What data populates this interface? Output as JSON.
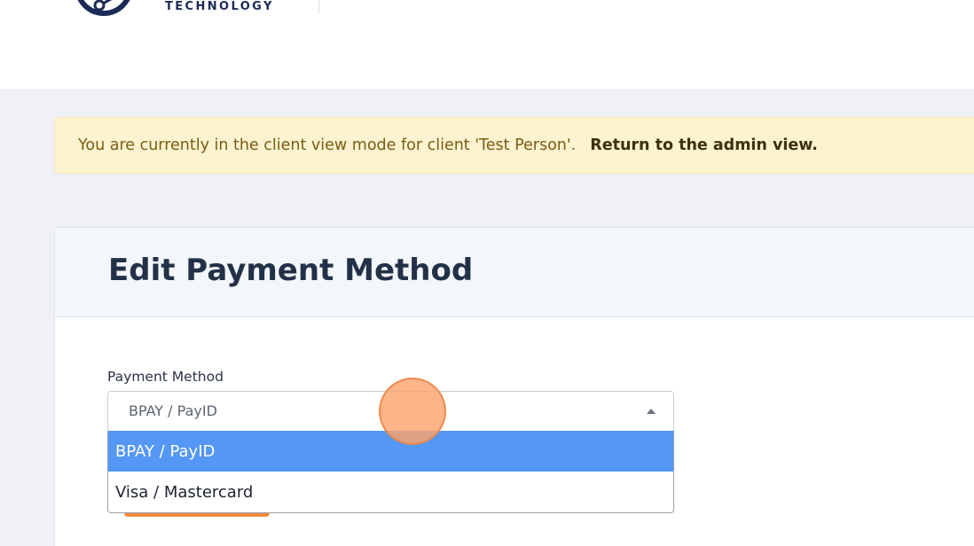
{
  "header": {
    "logo_text": "TECHNOLOGY",
    "logo_icon": "circle-network-logo-icon"
  },
  "alert": {
    "message": "You are currently in the client view mode for client 'Test Person'.",
    "link_label": "Return to the admin view."
  },
  "card": {
    "title": "Edit Payment Method"
  },
  "form": {
    "payment_method_label": "Payment Method",
    "payment_method_value": "BPAY / PayID",
    "options": [
      {
        "label": "BPAY / PayID",
        "selected": true
      },
      {
        "label": "Visa / Mastercard",
        "selected": false
      }
    ]
  },
  "colors": {
    "brand_navy": "#1b2b57",
    "alert_bg": "#fdf3d1",
    "option_highlight": "#5597f4",
    "accent_orange": "#f08a3c"
  }
}
